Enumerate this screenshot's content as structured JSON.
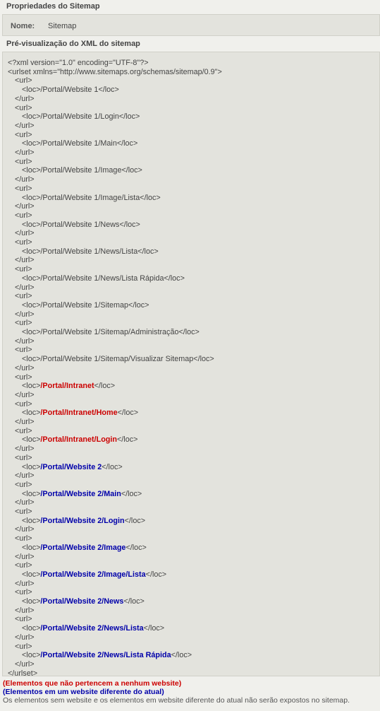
{
  "properties": {
    "title": "Propriedades do Sitemap",
    "name_label": "Nome:",
    "name_value": "Sitemap"
  },
  "preview": {
    "title": "Pré-visualização do XML do sitemap",
    "xml_declaration": "<?xml version=\"1.0\" encoding=\"UTF-8\"?>",
    "urlset_open": "<urlset xmlns=\"http://www.sitemaps.org/schemas/sitemap/0.9\">",
    "urlset_close": "</urlset>",
    "url_open": "<url>",
    "url_close": "</url>",
    "loc_open": "<loc>",
    "loc_close": "</loc>",
    "entries": [
      {
        "path": "/Portal/Website 1",
        "type": "normal"
      },
      {
        "path": "/Portal/Website 1/Login",
        "type": "normal"
      },
      {
        "path": "/Portal/Website 1/Main",
        "type": "normal"
      },
      {
        "path": "/Portal/Website 1/Image",
        "type": "normal"
      },
      {
        "path": "/Portal/Website 1/Image/Lista",
        "type": "normal"
      },
      {
        "path": "/Portal/Website 1/News",
        "type": "normal"
      },
      {
        "path": "/Portal/Website 1/News/Lista",
        "type": "normal"
      },
      {
        "path": "/Portal/Website 1/News/Lista Rápida",
        "type": "normal"
      },
      {
        "path": "/Portal/Website 1/Sitemap",
        "type": "normal"
      },
      {
        "path": "/Portal/Website 1/Sitemap/Administração",
        "type": "normal"
      },
      {
        "path": "/Portal/Website 1/Sitemap/Visualizar Sitemap",
        "type": "normal"
      },
      {
        "path": "/Portal/Intranet",
        "type": "no-website"
      },
      {
        "path": "/Portal/Intranet/Home",
        "type": "no-website"
      },
      {
        "path": "/Portal/Intranet/Login",
        "type": "no-website"
      },
      {
        "path": "/Portal/Website 2",
        "type": "other-website"
      },
      {
        "path": "/Portal/Website 2/Main",
        "type": "other-website"
      },
      {
        "path": "/Portal/Website 2/Login",
        "type": "other-website"
      },
      {
        "path": "/Portal/Website 2/Image",
        "type": "other-website"
      },
      {
        "path": "/Portal/Website 2/Image/Lista",
        "type": "other-website"
      },
      {
        "path": "/Portal/Website 2/News",
        "type": "other-website"
      },
      {
        "path": "/Portal/Website 2/News/Lista",
        "type": "other-website"
      },
      {
        "path": "/Portal/Website 2/News/Lista Rápida",
        "type": "other-website"
      }
    ]
  },
  "legend": {
    "no_website": "(Elementos que não pertencem a nenhum website)",
    "other_website": "(Elementos em um website diferente do atual)",
    "note": "Os elementos sem website e os elementos em website diferente do atual não serão expostos no sitemap."
  },
  "colors": {
    "no_website": "#cc0000",
    "other_website": "#0000aa",
    "panel_bg": "#e3e3dd"
  }
}
